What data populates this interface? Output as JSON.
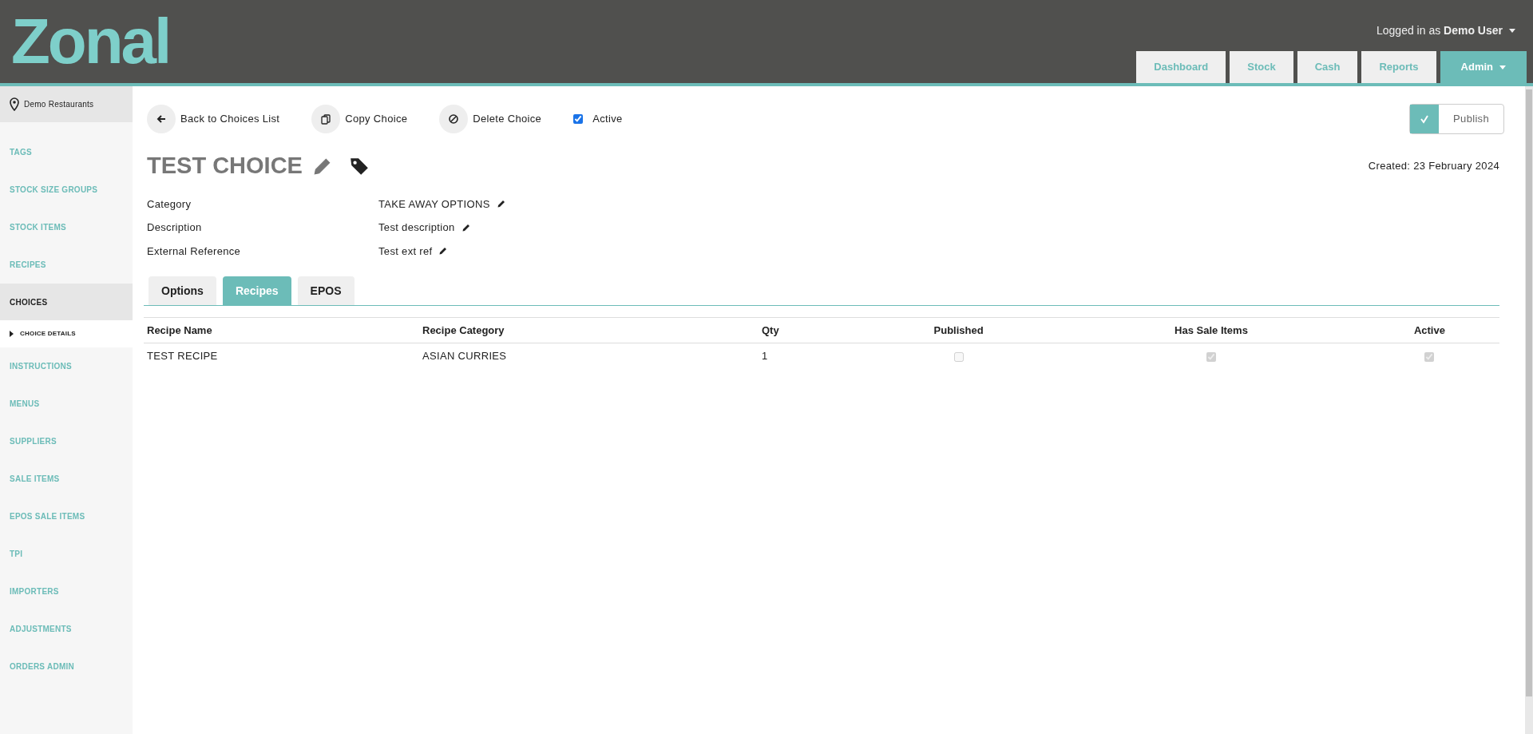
{
  "header": {
    "logo": "Zonal",
    "user_prefix": "Logged in as",
    "user_name": "Demo User",
    "nav": [
      {
        "label": "Dashboard",
        "selected": false,
        "dropdown": false
      },
      {
        "label": "Stock",
        "selected": false,
        "dropdown": false
      },
      {
        "label": "Cash",
        "selected": false,
        "dropdown": false
      },
      {
        "label": "Reports",
        "selected": false,
        "dropdown": false
      },
      {
        "label": "Admin",
        "selected": true,
        "dropdown": true
      }
    ]
  },
  "sidebar": {
    "location": "Demo Restaurants",
    "items": [
      {
        "label": "TAGS",
        "selected": false
      },
      {
        "label": "STOCK SIZE GROUPS",
        "selected": false
      },
      {
        "label": "STOCK ITEMS",
        "selected": false
      },
      {
        "label": "RECIPES",
        "selected": false
      },
      {
        "label": "CHOICES",
        "selected": true,
        "children": [
          {
            "label": "CHOICE DETAILS",
            "selected": true
          }
        ]
      },
      {
        "label": "INSTRUCTIONS",
        "selected": false
      },
      {
        "label": "MENUS",
        "selected": false
      },
      {
        "label": "SUPPLIERS",
        "selected": false
      },
      {
        "label": "SALE ITEMS",
        "selected": false
      },
      {
        "label": "EPOS SALE ITEMS",
        "selected": false
      },
      {
        "label": "TPI",
        "selected": false
      },
      {
        "label": "IMPORTERS",
        "selected": false
      },
      {
        "label": "ADJUSTMENTS",
        "selected": false
      },
      {
        "label": "ORDERS ADMIN",
        "selected": false
      }
    ]
  },
  "toolbar": {
    "actions": [
      {
        "kind": "back",
        "label": "Back to Choices List"
      },
      {
        "kind": "copy",
        "label": "Copy Choice"
      },
      {
        "kind": "delete",
        "label": "Delete Choice"
      }
    ],
    "active": {
      "label": "Active",
      "checked": true
    },
    "publish": {
      "label": "Publish",
      "checked": true
    }
  },
  "title": "TEST CHOICE",
  "created": "Created: 23 February 2024",
  "fields": [
    {
      "label": "Category",
      "value": "TAKE AWAY OPTIONS"
    },
    {
      "label": "Description",
      "value": "Test description"
    },
    {
      "label": "External Reference",
      "value": "Test ext ref"
    }
  ],
  "tabs": [
    {
      "label": "Options",
      "selected": false
    },
    {
      "label": "Recipes",
      "selected": true
    },
    {
      "label": "EPOS",
      "selected": false
    }
  ],
  "table": {
    "columns": [
      "Recipe Name",
      "Recipe Category",
      "Qty",
      "Published",
      "Has Sale Items",
      "Active"
    ],
    "rows": [
      {
        "name": "TEST RECIPE",
        "category": "ASIAN CURRIES",
        "qty": "1",
        "published": false,
        "has_sale_items": true,
        "active": true
      }
    ]
  }
}
